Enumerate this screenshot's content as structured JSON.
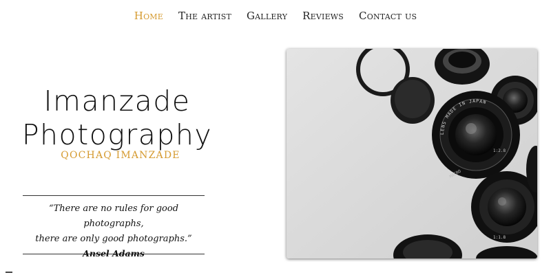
{
  "nav": {
    "items": [
      {
        "label": "Home",
        "active": true
      },
      {
        "label": "The artist",
        "active": false
      },
      {
        "label": "Gallery",
        "active": false
      },
      {
        "label": "Reviews",
        "active": false
      },
      {
        "label": "Contact us",
        "active": false
      }
    ]
  },
  "hero": {
    "title_line1": "Imanzade",
    "title_line2": "Photography",
    "subtitle": "QOCHAQ IMANZADE"
  },
  "quote": {
    "text_line1": "“There are no rules for good photographs,",
    "text_line2": "there are only good photographs.”",
    "author": "Ansel Adams"
  },
  "image": {
    "lens_text_1": "LENS MADE IN JAPAN",
    "lens_text_2": "1:2.8",
    "lens_text_3": "1:1.8",
    "lens_text_4": "MACRO"
  },
  "colors": {
    "accent": "#d59a2f",
    "text": "#111111",
    "background": "#ffffff"
  }
}
